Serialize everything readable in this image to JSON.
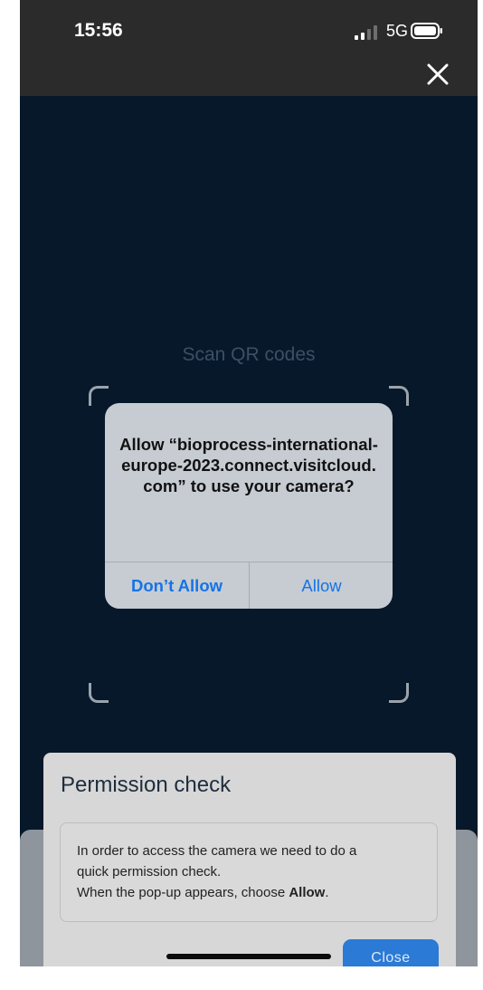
{
  "status_bar": {
    "time": "15:56",
    "network": "5G",
    "icons": [
      "signal-icon",
      "battery-icon"
    ]
  },
  "header": {
    "close_icon": "close-icon"
  },
  "scanner": {
    "label": "Scan QR codes"
  },
  "ios_alert": {
    "message": "Allow “bioprocess-international-europe-2023.connect.visitcloud.com” to use your camera?",
    "dont_allow_label": "Don’t Allow",
    "allow_label": "Allow",
    "button_color": "#1673e6"
  },
  "permission_check": {
    "title": "Permission check",
    "line1": "In order to access the camera we need to do a",
    "line2": "quick permission check.",
    "line3_prefix": "When the pop-up appears, choose ",
    "line3_bold": "Allow",
    "line3_suffix": ".",
    "close_label": "Close",
    "close_color": "#2a7ad6"
  },
  "colors": {
    "background": "#06182a",
    "status_bar": "#2b2b2b"
  }
}
